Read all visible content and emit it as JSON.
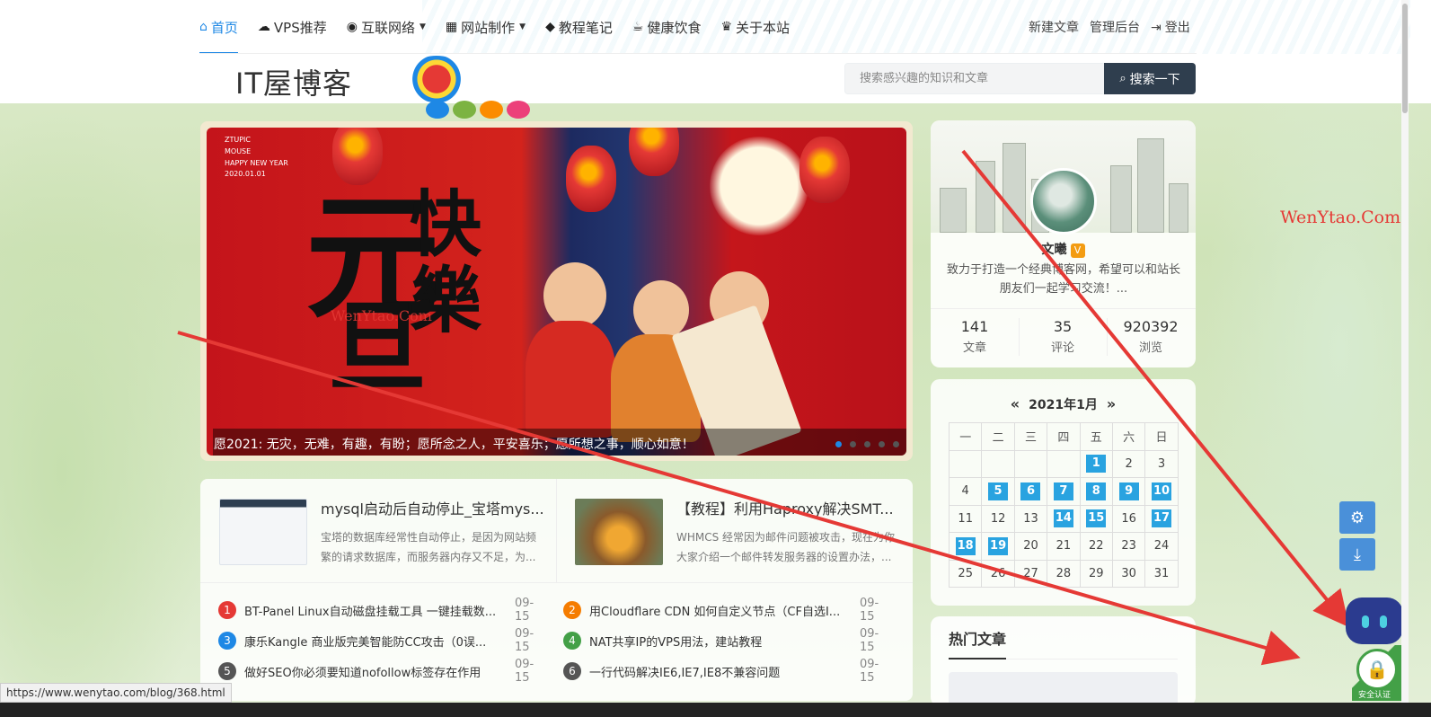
{
  "nav": {
    "items": [
      {
        "label": "首页",
        "icon": "home-icon",
        "glyph": "⌂",
        "active": true,
        "dropdown": false
      },
      {
        "label": "VPS推荐",
        "icon": "cloud-icon",
        "glyph": "☁",
        "active": false,
        "dropdown": false
      },
      {
        "label": "互联网络",
        "icon": "globe-icon",
        "glyph": "◉",
        "active": false,
        "dropdown": true
      },
      {
        "label": "网站制作",
        "icon": "windows-icon",
        "glyph": "▦",
        "active": false,
        "dropdown": true
      },
      {
        "label": "教程笔记",
        "icon": "graduation-cap-icon",
        "glyph": "◆",
        "active": false,
        "dropdown": false
      },
      {
        "label": "健康饮食",
        "icon": "coffee-icon",
        "glyph": "☕",
        "active": false,
        "dropdown": false
      },
      {
        "label": "关于本站",
        "icon": "crown-icon",
        "glyph": "♛",
        "active": false,
        "dropdown": false
      }
    ],
    "right": {
      "new_post": "新建文章",
      "admin": "管理后台",
      "logout": "登出"
    }
  },
  "logo": {
    "text": "IT屋博客"
  },
  "search": {
    "placeholder": "搜索感兴趣的知识和文章",
    "button": "搜索一下"
  },
  "slider": {
    "caption": "愿2021: 无灾，无难，有趣，有盼；愿所念之人，平安喜乐；愿所想之事，顺心如意！",
    "active_dot": 0,
    "dot_count": 5,
    "overlay_watermark": "WenYtao.Com",
    "corner_lines": [
      "ZTUPIC",
      "MOUSE",
      "HAPPY NEW YEAR",
      "2020.01.01"
    ],
    "big_chars": [
      "元",
      "旦",
      "快",
      "樂"
    ]
  },
  "cards": [
    {
      "title": "mysql启动后自动停止_宝塔mys...",
      "desc": "宝塔的数据库经常性自动停止，是因为网站频繁的请求数据库，而服务器内存又不足，为..."
    },
    {
      "title": "【教程】利用Haproxy解决SMT...",
      "desc": "WHMCS 经常因为邮件问题被攻击，现在为你大家介绍一个邮件转发服务器的设置办法，..."
    }
  ],
  "list": [
    {
      "num": "1",
      "color": "#e53935",
      "title": "BT-Panel Linux自动磁盘挂载工具 一键挂载数...",
      "date": "09-15"
    },
    {
      "num": "2",
      "color": "#f57c00",
      "title": "用Cloudflare CDN 如何自定义节点（CF自选I...",
      "date": "09-15"
    },
    {
      "num": "3",
      "color": "#1e88e5",
      "title": "康乐Kangle 商业版完美智能防CC攻击（0误...",
      "date": "09-15"
    },
    {
      "num": "4",
      "color": "#43a047",
      "title": "NAT共享IP的VPS用法，建站教程",
      "date": "09-15"
    },
    {
      "num": "5",
      "color": "#555555",
      "title": "做好SEO你必须要知道nofollow标签存在作用",
      "date": "09-15"
    },
    {
      "num": "6",
      "color": "#555555",
      "title": "一行代码解决IE6,IE7,IE8不兼容问题",
      "date": "09-15"
    }
  ],
  "profile": {
    "name": "文曦",
    "badge": "V",
    "desc": "致力于打造一个经典博客网，希望可以和站长朋友们一起学习交流！...",
    "stats": [
      {
        "value": "141",
        "label": "文章"
      },
      {
        "value": "35",
        "label": "评论"
      },
      {
        "value": "920392",
        "label": "浏览"
      }
    ]
  },
  "calendar": {
    "prev": "«",
    "next": "»",
    "title": "2021年1月",
    "weekdays": [
      "一",
      "二",
      "三",
      "四",
      "五",
      "六",
      "日"
    ],
    "weeks": [
      [
        "",
        "",
        "",
        "",
        "1",
        "2",
        "3"
      ],
      [
        "4",
        "5",
        "6",
        "7",
        "8",
        "9",
        "10"
      ],
      [
        "11",
        "12",
        "13",
        "14",
        "15",
        "16",
        "17"
      ],
      [
        "18",
        "19",
        "20",
        "21",
        "22",
        "23",
        "24"
      ],
      [
        "25",
        "26",
        "27",
        "28",
        "29",
        "30",
        "31"
      ]
    ],
    "highlighted": [
      "1",
      "5",
      "6",
      "7",
      "8",
      "9",
      "10",
      "14",
      "15",
      "17",
      "18",
      "19"
    ]
  },
  "hot": {
    "title": "热门文章"
  },
  "tools": {
    "settings_icon": "gear-icon",
    "download_icon": "download-icon"
  },
  "watermark": "WenYtao.Com",
  "seal": {
    "label": "安全认证"
  },
  "status_url": "https://www.wenytao.com/blog/368.html",
  "colors": {
    "accent": "#1e88e5",
    "search_btn": "#2f3e4e",
    "calendar_hl": "#29a3e0",
    "arrow": "#e53935"
  }
}
